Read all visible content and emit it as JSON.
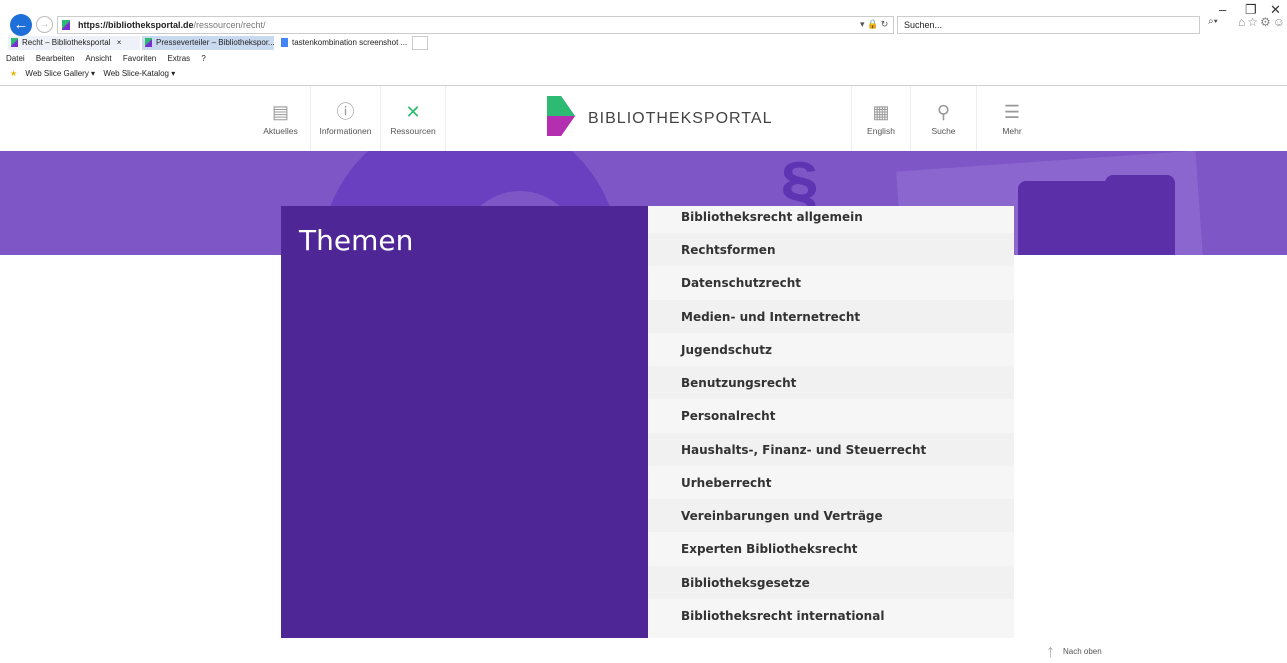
{
  "browser": {
    "url_host": "https://bibliotheksportal.de",
    "url_path": "/ressourcen/recht/",
    "search_placeholder": "Suchen...",
    "tabs": [
      {
        "label": "Recht – Bibliotheksportal"
      },
      {
        "label": "Presseverteiler – Bibliothekspor..."
      },
      {
        "label": "tastenkombination screenshot ..."
      }
    ],
    "menu": [
      "Datei",
      "Bearbeiten",
      "Ansicht",
      "Favoriten",
      "Extras",
      "?"
    ],
    "favorites": [
      "Web Slice Gallery ▾",
      "Web Slice-Katalog ▾"
    ]
  },
  "header": {
    "nav_left": [
      {
        "label": "Aktuelles",
        "icon": "news-icon"
      },
      {
        "label": "Informationen",
        "icon": "info-icon"
      },
      {
        "label": "Ressourcen",
        "icon": "tools-icon"
      }
    ],
    "brand": "BIBLIOTHEKSPORTAL",
    "nav_right": [
      {
        "label": "English",
        "icon": "flag-uk-icon"
      },
      {
        "label": "Suche",
        "icon": "search-icon"
      },
      {
        "label": "Mehr",
        "icon": "menu-icon"
      }
    ]
  },
  "main": {
    "title": "Themen",
    "topics": [
      "Bibliotheksrecht allgemein",
      "Rechtsformen",
      "Datenschutzrecht",
      "Medien- und Internetrecht",
      "Jugendschutz",
      "Benutzungsrecht",
      "Personalrecht",
      "Haushalts-, Finanz- und Steuerrecht",
      "Urheberrecht",
      "Vereinbarungen und Verträge",
      "Experten Bibliotheksrecht",
      "Bibliotheksgesetze",
      "Bibliotheksrecht international"
    ]
  },
  "footer": {
    "back_to_top": "Nach oben"
  },
  "colors": {
    "purple_dark": "#4f2695",
    "purple_banner": "#7e56c6",
    "brand_green": "#2dbb73"
  }
}
